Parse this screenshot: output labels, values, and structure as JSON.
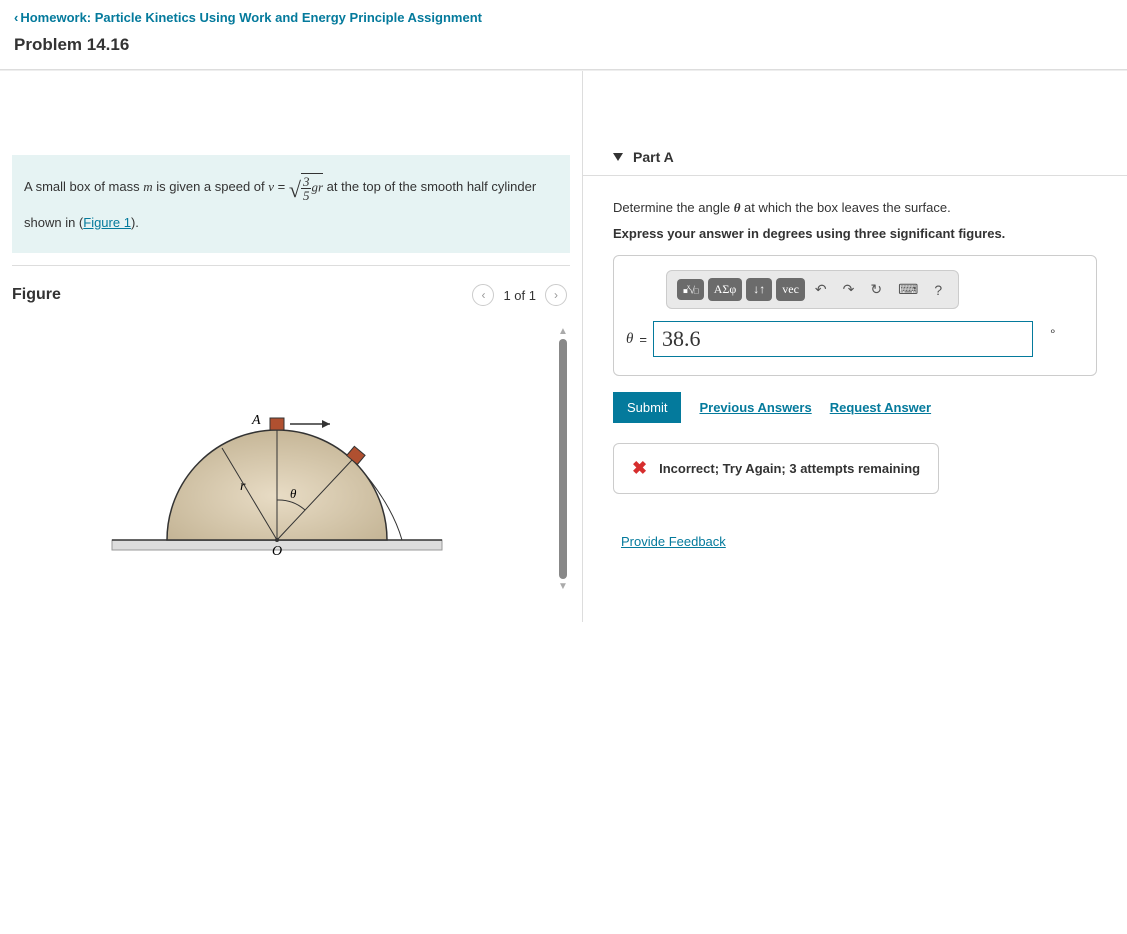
{
  "header": {
    "back_link": "Homework: Particle Kinetics Using Work and Energy Principle Assignment",
    "problem_title": "Problem 14.16"
  },
  "prompt": {
    "text_before": "A small box of mass ",
    "var_m": "m",
    "text_mid1": " is given a speed of ",
    "var_v": "v",
    "equals": " = ",
    "frac_num": "3",
    "frac_den": "5",
    "frac_after": "gr",
    "text_after": " at the top of the smooth half cylinder shown in (",
    "figure_link": "Figure 1",
    "text_end": ")."
  },
  "figure": {
    "label": "Figure",
    "count": "1 of 1",
    "point_A": "A",
    "point_O": "O",
    "radius_label": "r",
    "angle_label": "θ"
  },
  "partA": {
    "title": "Part A",
    "instruction1_a": "Determine the angle ",
    "instruction1_theta": "θ",
    "instruction1_b": " at which the box leaves the surface.",
    "instruction2": "Express your answer in degrees using three significant figures.",
    "toolbar": {
      "templates": "■√□",
      "greek": "ΑΣφ",
      "arrows": "↓↑",
      "vec": "vec",
      "help": "?"
    },
    "theta_label": "θ",
    "equals": " = ",
    "value": "38.6",
    "unit": "∘",
    "submit": "Submit",
    "prev_answers": "Previous Answers",
    "request_answer": "Request Answer",
    "feedback": "Incorrect; Try Again; 3 attempts remaining"
  },
  "provide_feedback": "Provide Feedback"
}
